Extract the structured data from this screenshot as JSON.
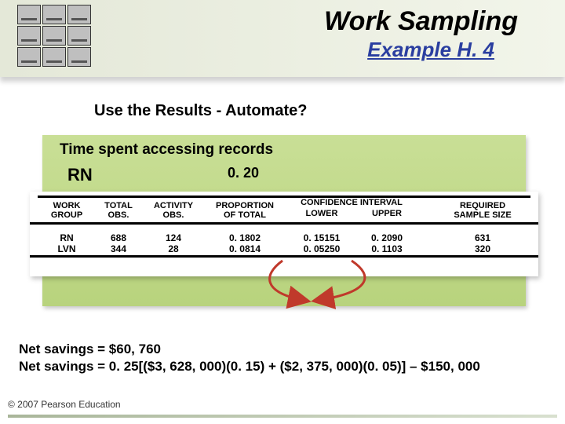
{
  "header": {
    "title": "Work Sampling",
    "subtitle": "Example H. 4"
  },
  "section_heading": "Use the Results - Automate?",
  "panel": {
    "title": "Time spent accessing records",
    "rn_label": "RN",
    "rn_value": "0. 20"
  },
  "table": {
    "headers": {
      "work_group": "WORK\nGROUP",
      "total_obs": "TOTAL\nOBS.",
      "activity_obs": "ACTIVITY\nOBS.",
      "proportion": "PROPORTION\nOF TOTAL",
      "conf_interval": "CONFIDENCE INTERVAL",
      "lower": "LOWER",
      "upper": "UPPER",
      "required": "REQUIRED\nSAMPLE SIZE"
    },
    "rows": [
      {
        "group": "RN",
        "total": "688",
        "activity": "124",
        "proportion": "0. 1802",
        "lower": "0. 15151",
        "upper": "0. 2090",
        "required": "631"
      },
      {
        "group": "LVN",
        "total": "344",
        "activity": "28",
        "proportion": "0. 0814",
        "lower": "0. 05250",
        "upper": "0. 1103",
        "required": "320"
      }
    ]
  },
  "chart_data": {
    "type": "table",
    "columns": [
      "WORK GROUP",
      "TOTAL OBS.",
      "ACTIVITY OBS.",
      "PROPORTION OF TOTAL",
      "CONF. LOWER",
      "CONF. UPPER",
      "REQUIRED SAMPLE SIZE"
    ],
    "rows": [
      [
        "RN",
        688,
        124,
        0.1802,
        0.15151,
        0.209,
        631
      ],
      [
        "LVN",
        344,
        28,
        0.0814,
        0.0525,
        0.1103,
        320
      ]
    ]
  },
  "savings": {
    "line1": "Net savings = $60, 760",
    "line2": "Net savings = 0. 25[($3, 628, 000)(0. 15)  + ($2, 375, 000)(0. 05)] – $150, 000"
  },
  "copyright": "© 2007 Pearson Education"
}
